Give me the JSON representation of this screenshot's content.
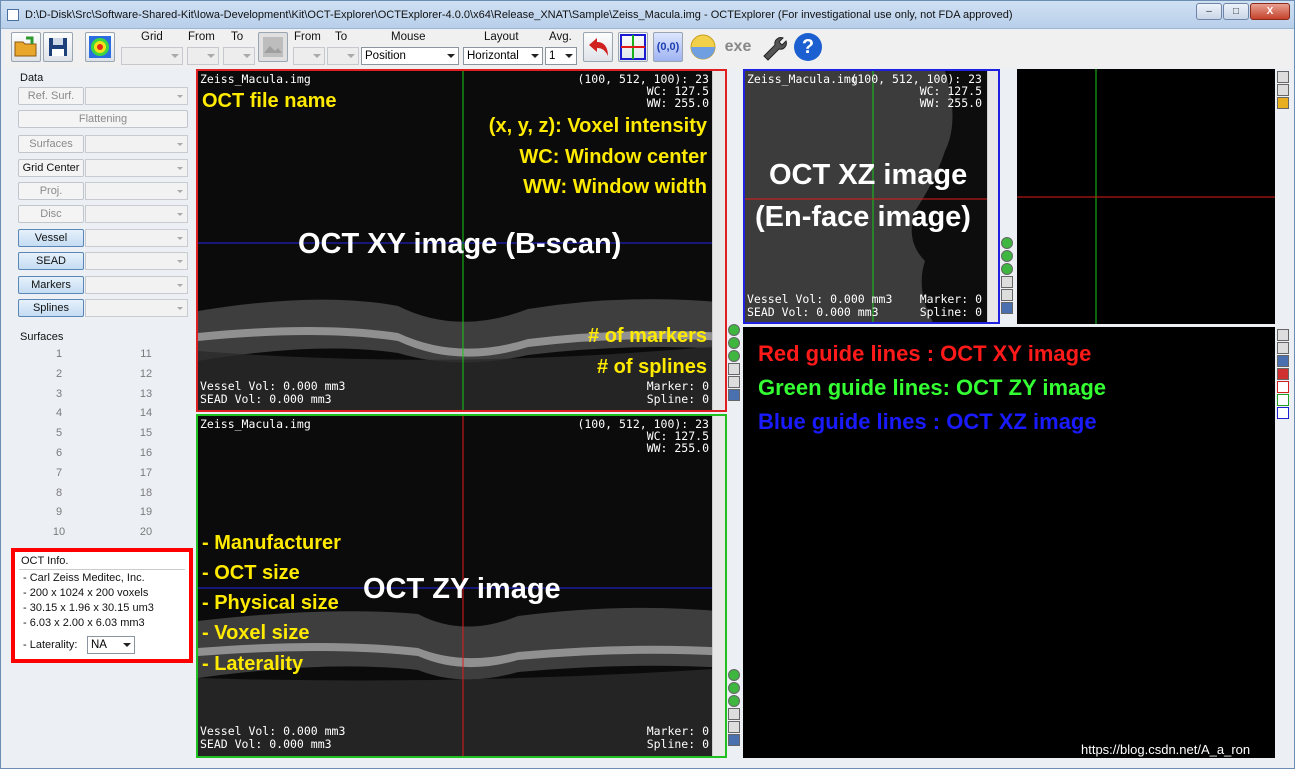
{
  "window": {
    "title": "D:\\D-Disk\\Src\\Software-Shared-Kit\\Iowa-Development\\Kit\\OCT-Explorer\\OCTExplorer-4.0.0\\x64\\Release_XNAT\\Sample\\Zeiss_Macula.img - OCTExplorer (For investigational use only, not FDA approved)",
    "min": "–",
    "max": "□",
    "close": "X"
  },
  "toolbar": {
    "grid_label": "Grid",
    "from1_label": "From",
    "to1_label": "To",
    "from2_label": "From",
    "to2_label": "To",
    "mouse_label": "Mouse",
    "mouse_value": "Position",
    "layout_label": "Layout",
    "layout_value": "Horizontal",
    "avg_label": "Avg.",
    "avg_value": "1",
    "coord_btn": "(0,0)",
    "exe_btn": "exe",
    "help_btn": "?"
  },
  "left": {
    "data_label": "Data",
    "ref_surf": "Ref. Surf.",
    "flattening": "Flattening",
    "surfaces_btn": "Surfaces",
    "grid_center": "Grid Center",
    "proj": "Proj.",
    "disc": "Disc",
    "vessel": "Vessel",
    "sead": "SEAD",
    "markers": "Markers",
    "splines": "Splines",
    "surfaces_label": "Surfaces",
    "surface_col1": [
      "1",
      "2",
      "3",
      "4",
      "5",
      "6",
      "7",
      "8",
      "9",
      "10"
    ],
    "surface_col2": [
      "11",
      "12",
      "13",
      "14",
      "15",
      "16",
      "17",
      "18",
      "19",
      "20"
    ],
    "oct_info_label": "OCT Info.",
    "oct_info": [
      "- Carl Zeiss Meditec, Inc.",
      "- 200 x 1024 x 200 voxels",
      "- 30.15 x 1.96 x 30.15 um3",
      "- 6.03 x 2.00 x 6.03 mm3"
    ],
    "laterality_label": "- Laterality:",
    "laterality_value": "NA"
  },
  "xy": {
    "file": "Zeiss_Macula.img",
    "coord": "(100, 512, 100): 23",
    "wc": "WC: 127.5",
    "ww": "WW: 255.0",
    "vessel": "Vessel Vol: 0.000 mm3",
    "sead": "SEAD Vol: 0.000 mm3",
    "marker": "Marker: 0",
    "spline": "Spline: 0",
    "ann_file": "OCT file name",
    "ann_voxel": "(x, y, z): Voxel intensity",
    "ann_wc": "WC: Window center",
    "ann_ww": "WW: Window width",
    "ann_title": "OCT XY image (B-scan)",
    "ann_markers": "# of markers",
    "ann_splines": "# of splines"
  },
  "xz": {
    "file": "Zeiss_Macula.img",
    "coord": "(100, 512, 100): 23",
    "wc": "WC: 127.5",
    "ww": "WW: 255.0",
    "vessel": "Vessel Vol: 0.000 mm3",
    "sead": "SEAD Vol: 0.000 mm3",
    "marker": "Marker: 0",
    "spline": "Spline: 0",
    "ann_title1": "OCT XZ image",
    "ann_title2": "(En-face image)"
  },
  "zy": {
    "file": "Zeiss_Macula.img",
    "coord": "(100, 512, 100): 23",
    "wc": "WC: 127.5",
    "ww": "WW: 255.0",
    "vessel": "Vessel Vol: 0.000 mm3",
    "sead": "SEAD Vol: 0.000 mm3",
    "marker": "Marker: 0",
    "spline": "Spline: 0",
    "ann_title": "OCT ZY image",
    "ann_list": [
      "- Manufacturer",
      "- OCT size",
      "- Physical size",
      "- Voxel size",
      "- Laterality"
    ]
  },
  "legend": {
    "red": "Red guide lines    : OCT XY image",
    "green": "Green guide lines: OCT ZY image",
    "blue": "Blue guide lines   : OCT XZ image",
    "red_color": "#ff1a1a",
    "green_color": "#33ff33",
    "blue_color": "#1a1aff"
  },
  "watermark": "https://blog.csdn.net/A_a_ron"
}
